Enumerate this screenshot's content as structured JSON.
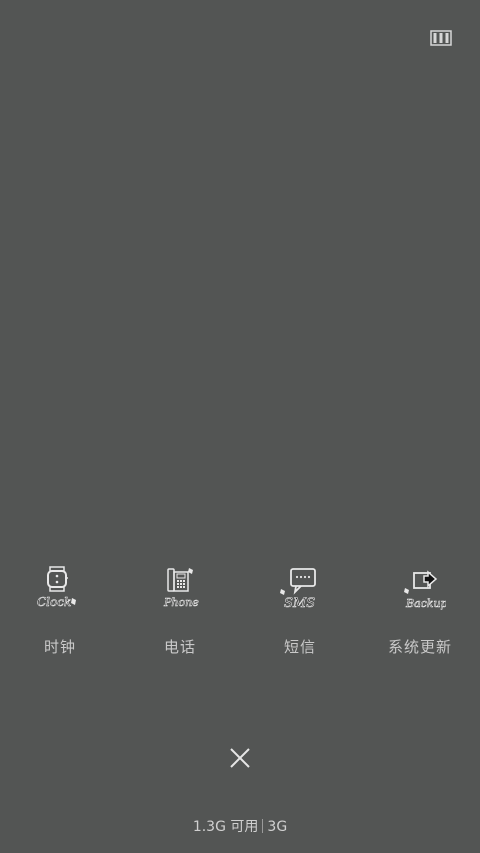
{
  "top_right_icon": "layout-icon",
  "apps": [
    {
      "name": "clock",
      "icon": "clock-icon",
      "icon_text": "Clock",
      "label": "时钟"
    },
    {
      "name": "phone",
      "icon": "phone-icon",
      "icon_text": "Phone",
      "label": "电话"
    },
    {
      "name": "sms",
      "icon": "sms-icon",
      "icon_text": "SMS",
      "label": "短信"
    },
    {
      "name": "backup",
      "icon": "backup-icon",
      "icon_text": "Backup",
      "label": "系统更新"
    }
  ],
  "close_icon": "close-icon",
  "memory": {
    "available": "1.3G 可用",
    "total": "3G"
  },
  "colors": {
    "background": "#535554",
    "text": "#c9c9c9"
  }
}
